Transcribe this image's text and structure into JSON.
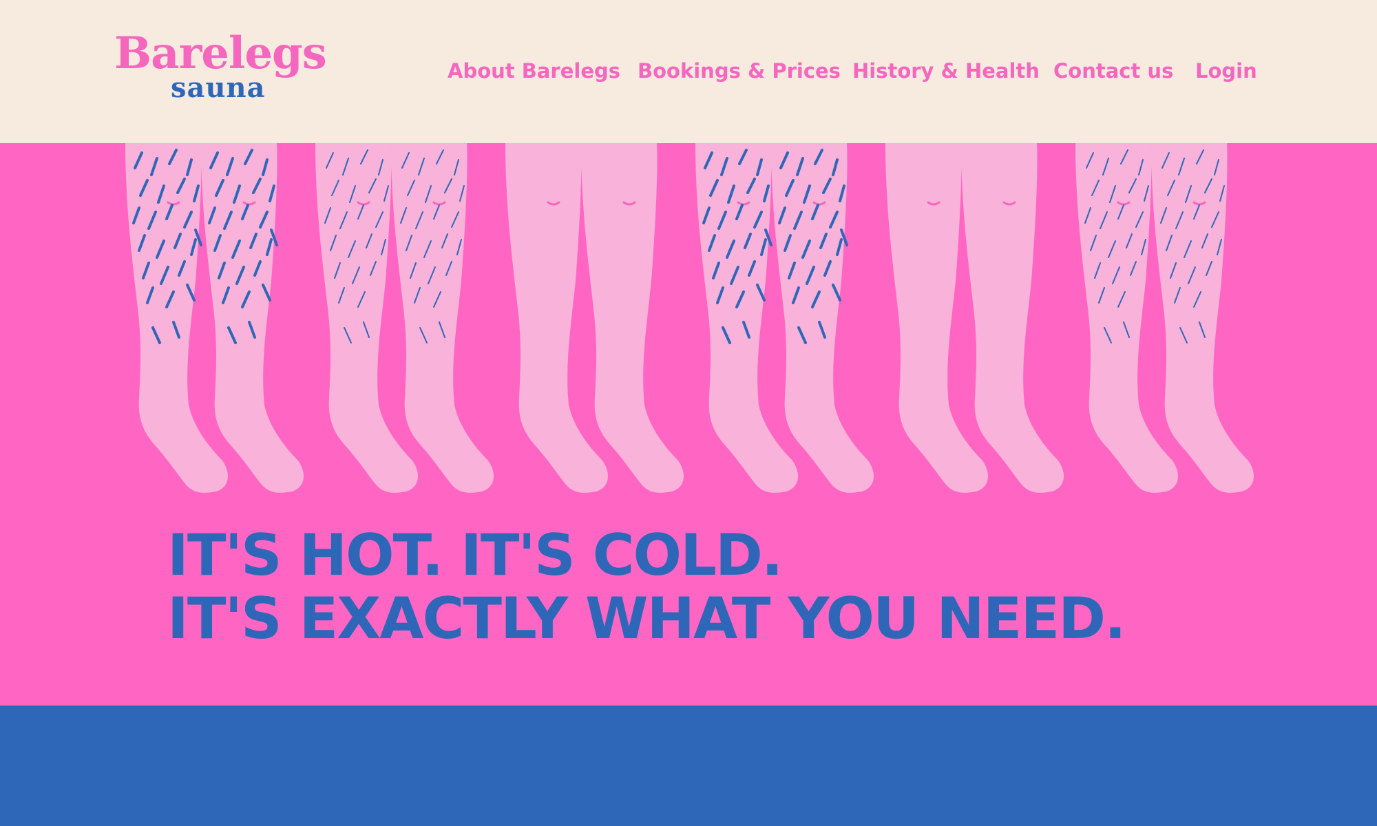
{
  "brand": {
    "name": "Barelegs",
    "subname": "sauna"
  },
  "nav": {
    "items": [
      {
        "label": "About Barelegs"
      },
      {
        "label": "Bookings & Prices"
      },
      {
        "label": "History & Health"
      },
      {
        "label": "Contact us"
      },
      {
        "label": "Login"
      }
    ]
  },
  "hero": {
    "headline_line1": "IT'S HOT. IT'S COLD.",
    "headline_line2": "IT'S EXACTLY WHAT YOU NEED.",
    "illustration": "row of legs with and without hair"
  },
  "colors": {
    "header_bg": "#f6ebde",
    "pink_brand": "#f567bf",
    "hero_bg": "#ff66c4",
    "leg": "#f9b2d9",
    "blue": "#2f67b8"
  }
}
